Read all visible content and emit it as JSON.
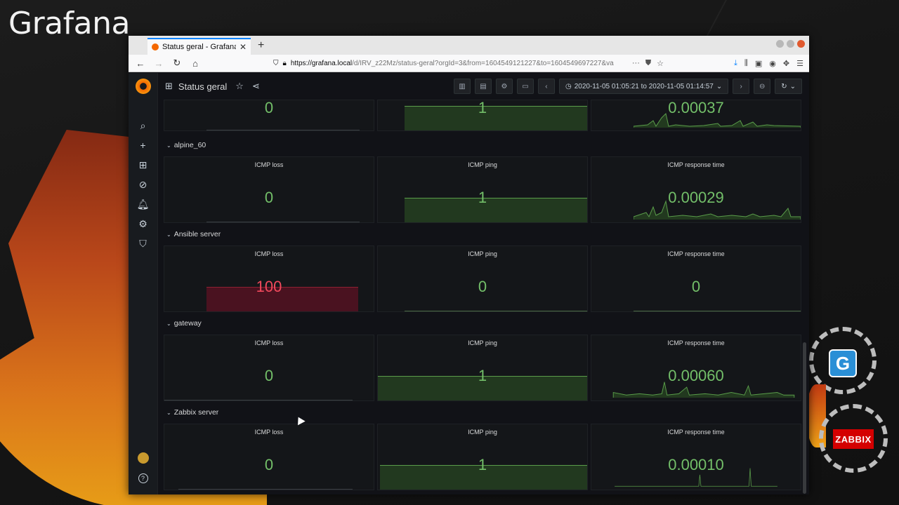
{
  "desktop": {
    "brand": "Grafana",
    "badge_g": "G",
    "badge_zabbix": "ZABBIX"
  },
  "browser": {
    "tab_title": "Status geral - Grafana",
    "url_domain": "https://grafana.local",
    "url_rest": "/d/IRV_z22Mz/status-geral?orgId=3&from=1604549121227&to=1604549697227&va",
    "url_overflow": "···"
  },
  "dashboard": {
    "title": "Status geral",
    "time_range": "2020-11-05 01:05:21 to 2020-11-05 01:14:57"
  },
  "panel_titles": {
    "loss": "ICMP loss",
    "ping": "ICMP ping",
    "response": "ICMP response time"
  },
  "rows": [
    {
      "name": "",
      "loss": "0",
      "ping": "1",
      "response": "0.00037"
    },
    {
      "name": "alpine_60",
      "loss": "0",
      "ping": "1",
      "response": "0.00029"
    },
    {
      "name": "Ansible server",
      "loss": "100",
      "ping": "0",
      "response": "0"
    },
    {
      "name": "gateway",
      "loss": "0",
      "ping": "1",
      "response": "0.00060"
    },
    {
      "name": "Zabbix server",
      "loss": "0",
      "ping": "1",
      "response": "0.00010"
    }
  ],
  "colors": {
    "ok": "#73bf69",
    "critical": "#f2495c",
    "background": "#111217"
  },
  "icons": {
    "side_menu": [
      "search-icon",
      "plus-icon",
      "dashboards-icon",
      "explore-icon",
      "alerting-icon",
      "config-icon",
      "shield-icon"
    ],
    "dash_buttons": [
      "add-panel-icon",
      "save-icon",
      "settings-icon",
      "tv-icon",
      "time-back-icon",
      "clock-icon",
      "time-forward-icon",
      "zoom-out-icon",
      "refresh-icon"
    ]
  }
}
